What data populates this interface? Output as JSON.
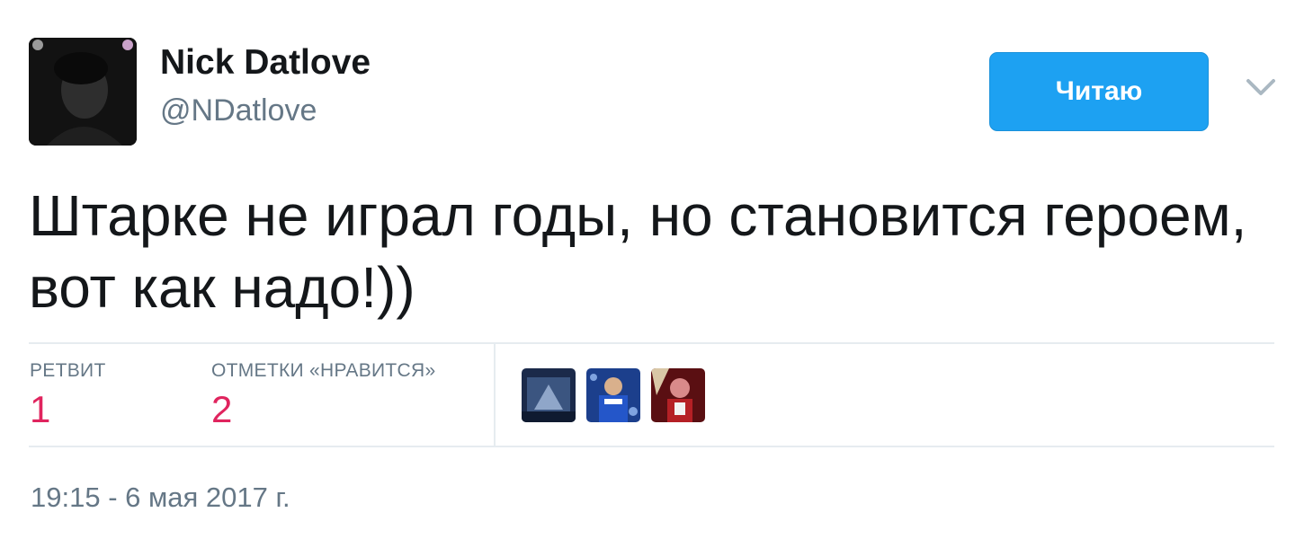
{
  "user": {
    "display_name": "Nick Datlove",
    "handle": "@NDatlove",
    "avatar_icon": "user-avatar-photo"
  },
  "follow_button": {
    "label": "Читаю"
  },
  "menu": {
    "icon": "chevron-down-icon"
  },
  "tweet": {
    "text": "Штарке не играл годы, но становится героем, вот как надо!))"
  },
  "stats": {
    "retweets_label": "РЕТВИТ",
    "retweets_count": "1",
    "likes_label": "ОТМЕТКИ «НРАВИТСЯ»",
    "likes_count": "2"
  },
  "likers": [
    {
      "icon": "liker-avatar-photo"
    },
    {
      "icon": "liker-avatar-photo"
    },
    {
      "icon": "liker-avatar-photo"
    }
  ],
  "timestamp": "19:15 - 6 мая 2017 г.",
  "colors": {
    "accent": "#1da1f2",
    "count": "#e0245e",
    "secondary_text": "#657786",
    "divider": "#e6ecf0"
  }
}
